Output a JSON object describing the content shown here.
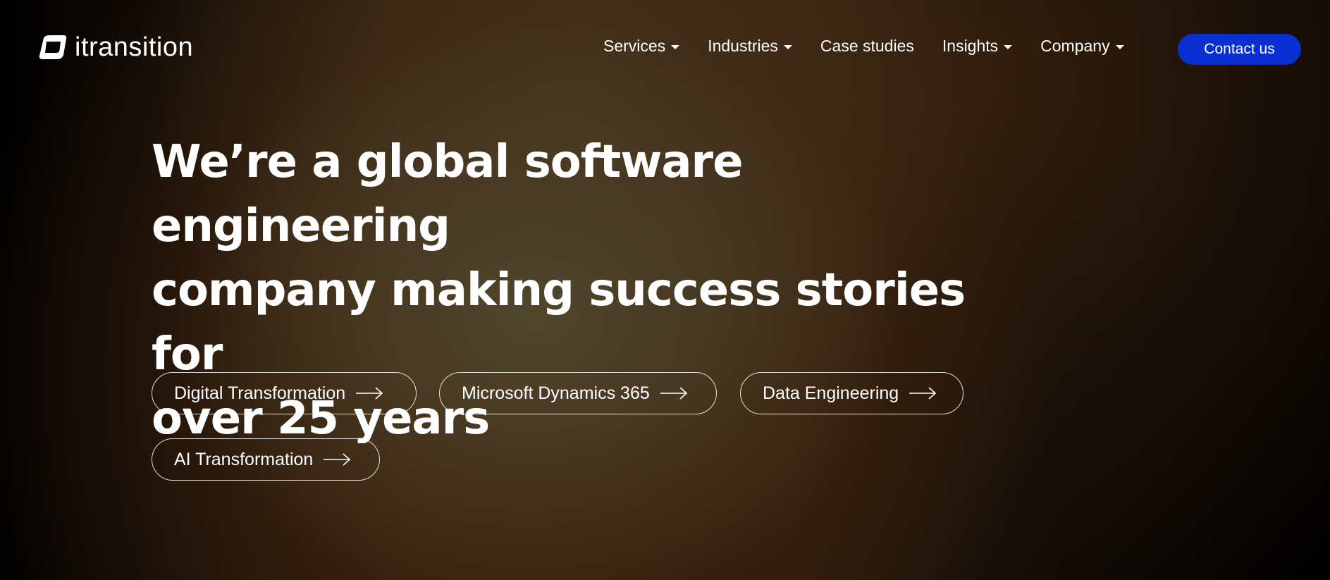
{
  "brand": {
    "name": "itransition"
  },
  "nav": {
    "items": [
      {
        "label": "Services",
        "has_dropdown": true
      },
      {
        "label": "Industries",
        "has_dropdown": true
      },
      {
        "label": "Case studies",
        "has_dropdown": false
      },
      {
        "label": "Insights",
        "has_dropdown": true
      },
      {
        "label": "Company",
        "has_dropdown": true
      }
    ],
    "contact_label": "Contact us"
  },
  "hero": {
    "title_lines": [
      "We’re a global software engineering",
      "company making success stories for",
      "over 25 years"
    ]
  },
  "pills": [
    {
      "label": "Digital Transformation",
      "icon": "arrow-right-icon"
    },
    {
      "label": "Microsoft Dynamics 365",
      "icon": "arrow-right-icon"
    },
    {
      "label": "Data Engineering",
      "icon": "arrow-right-icon"
    },
    {
      "label": "AI Transformation",
      "icon": "arrow-right-icon"
    }
  ],
  "colors": {
    "accent": "#0a2fd0",
    "text": "#ffffff",
    "background": "#000000",
    "glow": "#4a4530"
  }
}
